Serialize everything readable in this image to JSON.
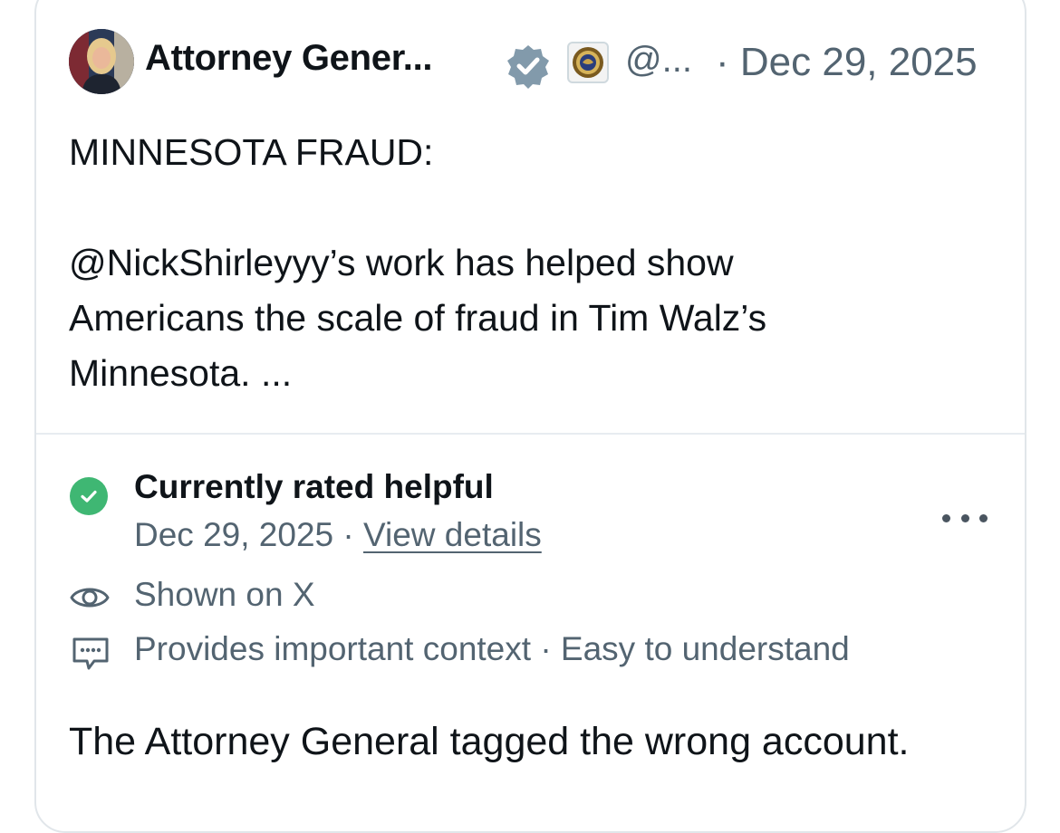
{
  "post": {
    "author_name": "Attorney Gener...",
    "handle": "@...",
    "date": "· Dec 29, 2025",
    "icons": {
      "avatar": "avatar",
      "verified": "verified-badge-icon",
      "affiliate": "doj-seal-icon"
    },
    "text_lines": [
      "MINNESOTA FRAUD:",
      "",
      "@NickShirleyyy’s work has helped show",
      "Americans the scale of fraud in Tim Walz’s",
      "Minnesota. ..."
    ]
  },
  "community_note": {
    "status": "Currently rated helpful",
    "date": "Dec 29, 2025",
    "separator": " · ",
    "details_link": "View details",
    "shown_on": "Shown on X",
    "reasons": "Provides important context · Easy to understand",
    "note_text": "The Attorney General tagged the wrong account.",
    "colors": {
      "helpful_green": "#3fb773",
      "verified_gray": "#829aab",
      "secondary_text": "#536471"
    },
    "icons": {
      "status": "check-circle-icon",
      "shown": "eye-icon",
      "reasons": "speech-bubble-icon",
      "menu": "more-icon"
    }
  }
}
